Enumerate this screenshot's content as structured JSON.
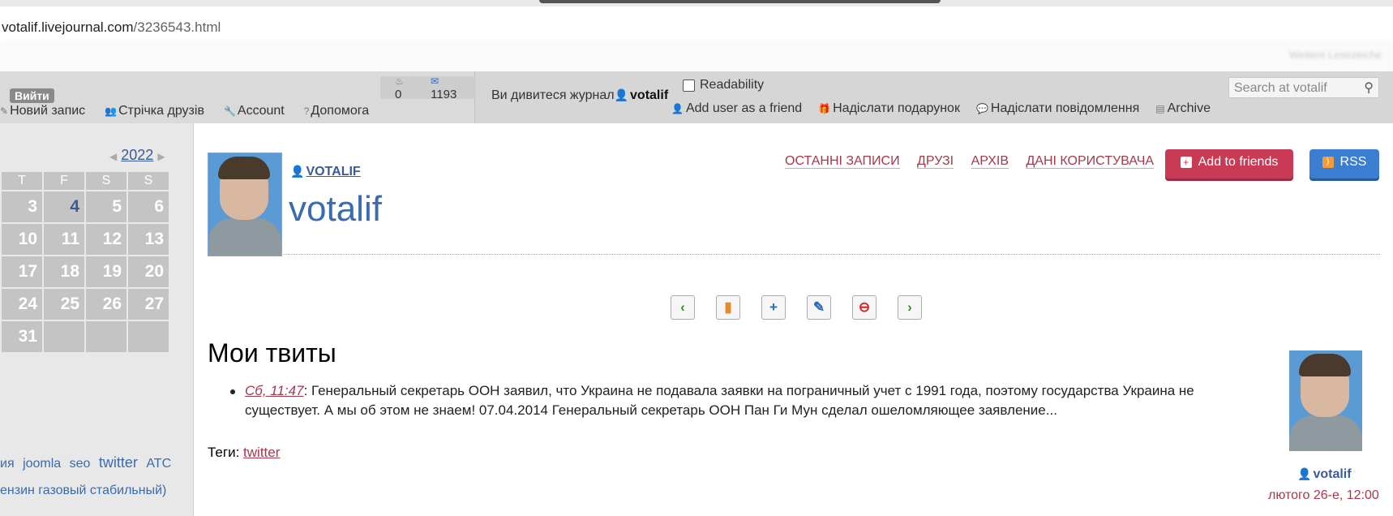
{
  "browser": {
    "url_host": "votalif.livejournal.com",
    "url_path": "/3236543.html",
    "bookmark_hint": "Weitere Lesezeiche"
  },
  "ljbar": {
    "logout": "Вийти",
    "new_post": "Новий запис",
    "friends_feed": "Стрічка друзів",
    "account": "Account",
    "help": "Допомога",
    "counter_a": "0",
    "counter_b": "1193",
    "viewing_prefix": "Ви дивитеся журнал",
    "viewing_user": "votalif",
    "readability": "Readability",
    "add_friend": "Add user as a friend",
    "send_gift": "Надіслати подарунок",
    "send_message": "Надіслати повідомлення",
    "archive": "Archive",
    "search_placeholder": "Search at votalif"
  },
  "sidebar": {
    "year": "2022",
    "weekdays": [
      "T",
      "F",
      "S",
      "S"
    ],
    "weeks": [
      [
        "3",
        "4",
        "5",
        "6"
      ],
      [
        "10",
        "11",
        "12",
        "13"
      ],
      [
        "17",
        "18",
        "19",
        "20"
      ],
      [
        "24",
        "25",
        "26",
        "27"
      ],
      [
        "31",
        "",
        "",
        ""
      ]
    ],
    "tags_line": [
      "ия",
      "joomla",
      "seo",
      "twitter",
      "АТС"
    ],
    "tags_line2": "ензин газовый стабильный)"
  },
  "header": {
    "username_link": "VOTALIF",
    "journal_title": "votalif",
    "nav": [
      "ОСТАННІ ЗАПИСИ",
      "ДРУЗІ",
      "АРХІВ",
      "ДАНІ КОРИСТУВАЧА"
    ],
    "add_friends": "Add to friends",
    "rss": "RSS"
  },
  "post": {
    "title": "Мои твиты",
    "timestamp": "Сб, 11:47",
    "text": ": Генеральный секретарь ООН заявил, что Украина не подавала заявки на пограничный учет с 1991 года, поэтому государства Украина не существует. А мы об этом не знаем! 07.04.2014 Генеральный секретарь ООН Пан Ги Мун сделал ошеломляющее заявление...",
    "tags_label": "Теги:",
    "tag": "twitter",
    "author": "votalif",
    "date": "лютого 26-е, 12:00"
  }
}
